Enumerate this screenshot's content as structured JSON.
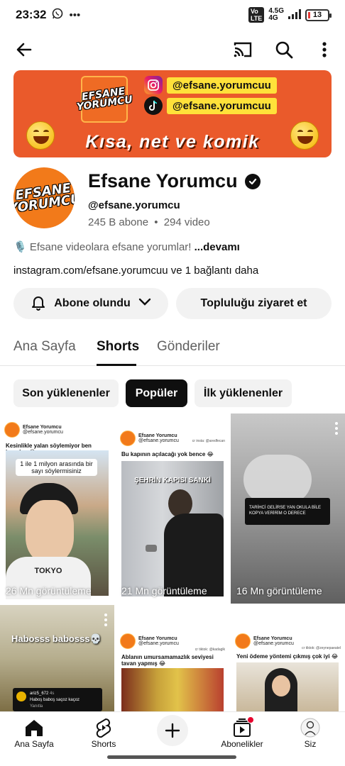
{
  "status_bar": {
    "time": "23:32",
    "network_type": "4.5G",
    "network_sub": "4G",
    "battery": "13",
    "colors": {
      "battery_low": "#e53935"
    }
  },
  "app_bar": {
    "icons": [
      "back-arrow-icon",
      "cast-icon",
      "search-icon",
      "more-vert-icon"
    ]
  },
  "banner": {
    "logo_line1": "EFSANE",
    "logo_line2": "YORUMCU",
    "instagram_handle": "@efsane.yorumcuu",
    "tiktok_handle": "@efsane.yorumcuu",
    "tagline": "Kısa, net ve komik",
    "colors": {
      "background": "#ea5a2b",
      "handle_bg": "#ffe13a"
    }
  },
  "channel": {
    "name": "Efsane Yorumcu",
    "handle": "@efsane.yorumcu",
    "subscribers": "245 B abone",
    "separator": "•",
    "videos": "294 video",
    "description": "🎙️ Efsane videolara efsane yorumlar! ",
    "description_more": "...devamı",
    "links": "instagram.com/efsane.yorumcuu ve 1 bağlantı daha"
  },
  "actions": {
    "subscribed_label": "Abone olundu",
    "community_label": "Topluluğu ziyaret et"
  },
  "tabs": [
    {
      "label": "Ana Sayfa",
      "active": false
    },
    {
      "label": "Shorts",
      "active": true
    },
    {
      "label": "Gönderiler",
      "active": false
    }
  ],
  "chips": [
    {
      "label": "Son yüklenenler",
      "selected": false
    },
    {
      "label": "Popüler",
      "selected": true
    },
    {
      "label": "İlk yüklenenler",
      "selected": false
    }
  ],
  "shorts": [
    {
      "mini_channel": "Efsane Yorumcu",
      "mini_handle": "@efsane.yorumcu",
      "title": "Kesinlikle yalan söylemiyor ben inandım 😂",
      "overlay": "1 ile 1 milyon arasında bir sayı söylermisiniz",
      "shirt": "TOKYO",
      "views": "26 Mn görüntüleme"
    },
    {
      "mini_channel": "Efsane Yorumcu",
      "mini_handle": "@efsane.yorumcu",
      "credit": "cr insta: @aredfecan",
      "title": "Bu kapının açılacağı yok bence 😂",
      "overlay": "ŞEHRİN KAPISI SANKİ",
      "views": "21 Mn görüntüleme"
    },
    {
      "comment": "TARİHCİ GELİRSE YAN OKULA BİLE KOPYA VERİRİM O DERECE",
      "views": "16 Mn görüntüleme"
    },
    {
      "overlay": "Habosss babosss💀",
      "comment_user": "ariz5_672",
      "comment_time": "4s",
      "comment_text": "Haboş baboş saçoz kaçoz",
      "comment_reply": "Yanıtla"
    },
    {
      "mini_channel": "Efsane Yorumcu",
      "mini_handle": "@efsane.yorumcu",
      "credit": "cr tiktok: @kadaglk",
      "title": "Ablanın umursamamazlık seviyesi tavan yapmış 😂"
    },
    {
      "mini_channel": "Efsane Yorumcu",
      "mini_handle": "@efsane.yorumcu",
      "credit": "cr tiktok: @zeynepaeatel",
      "title": "Yeni ödeme yöntemi çıkmış çok iyi 😂"
    }
  ],
  "bottom_nav": [
    {
      "label": "Ana Sayfa",
      "icon": "home-icon"
    },
    {
      "label": "Shorts",
      "icon": "shorts-icon"
    },
    {
      "label": "",
      "icon": "create-plus-icon"
    },
    {
      "label": "Abonelikler",
      "icon": "subscriptions-icon"
    },
    {
      "label": "Siz",
      "icon": "profile-avatar-icon"
    }
  ]
}
